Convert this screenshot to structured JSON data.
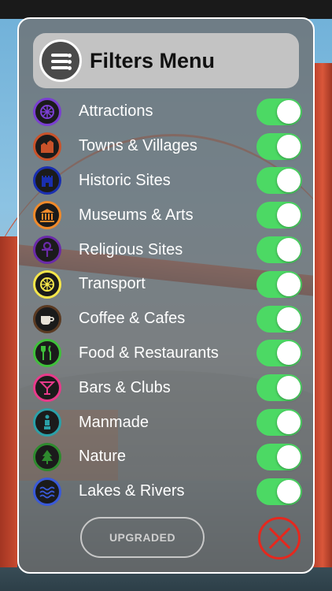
{
  "header": {
    "title": "Filters Menu",
    "icon": "menu-list-icon"
  },
  "filters": [
    {
      "label": "Attractions",
      "icon": "ferris-wheel-icon",
      "color": "#7a3fd1",
      "enabled": true
    },
    {
      "label": "Towns & Villages",
      "icon": "town-icon",
      "color": "#c9522a",
      "enabled": true
    },
    {
      "label": "Historic Sites",
      "icon": "castle-icon",
      "color": "#1a2fb0",
      "enabled": true
    },
    {
      "label": "Museums & Arts",
      "icon": "museum-icon",
      "color": "#f08a2a",
      "enabled": true
    },
    {
      "label": "Religious Sites",
      "icon": "ankh-icon",
      "color": "#6a2aa8",
      "enabled": true
    },
    {
      "label": "Transport",
      "icon": "wheel-icon",
      "color": "#f5e64a",
      "enabled": true
    },
    {
      "label": "Coffee & Cafes",
      "icon": "coffee-cup-icon",
      "color": "#5a3a22",
      "enabled": true
    },
    {
      "label": "Food & Restaurants",
      "icon": "fork-knife-icon",
      "color": "#3fbf3a",
      "enabled": true
    },
    {
      "label": "Bars & Clubs",
      "icon": "cocktail-glass-icon",
      "color": "#e83a8a",
      "enabled": true
    },
    {
      "label": "Manmade",
      "icon": "statue-icon",
      "color": "#2aa0a8",
      "enabled": true
    },
    {
      "label": "Nature",
      "icon": "tree-icon",
      "color": "#2e8a2e",
      "enabled": true
    },
    {
      "label": "Lakes & Rivers",
      "icon": "waves-icon",
      "color": "#3a5ad8",
      "enabled": true
    }
  ],
  "footer": {
    "upgraded_label": "UPGRADED",
    "close_icon": "close-icon"
  },
  "colors": {
    "toggle_on": "#4cd964",
    "close": "#e5281e"
  }
}
